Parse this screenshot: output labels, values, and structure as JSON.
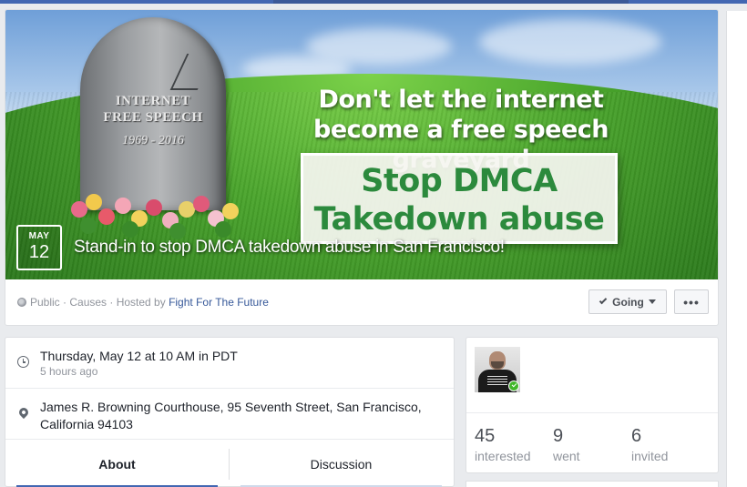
{
  "cover": {
    "tombstone_line1": "INTERNET",
    "tombstone_line2": "FREE SPEECH",
    "tombstone_years": "1969 - 2016",
    "headline": "Don't let the internet become a free speech graveyard",
    "banner_line1": "Stop DMCA",
    "banner_line2": "Takedown abuse"
  },
  "event": {
    "month": "MAY",
    "day": "12",
    "title": "Stand-in to stop DMCA takedown abuse in San Francisco!",
    "meta_prefix": "Public · Causes · Hosted by ",
    "host": "Fight For The Future"
  },
  "actions": {
    "going_label": "Going",
    "more_label": "•••"
  },
  "details": {
    "time": "Thursday, May 12 at 10 AM in PDT",
    "time_relative": "5 hours ago",
    "location": "James R. Browning Courthouse, 95 Seventh Street, San Francisco, California 94103"
  },
  "tabs": {
    "about": "About",
    "discussion": "Discussion"
  },
  "guests": {
    "interested_count": "45",
    "interested_label": "interested",
    "went_count": "9",
    "went_label": "went",
    "invited_count": "6",
    "invited_label": "invited"
  },
  "colors": {
    "facebook_blue": "#4267b2",
    "link": "#365899",
    "banner_green": "#2c8a3d"
  }
}
